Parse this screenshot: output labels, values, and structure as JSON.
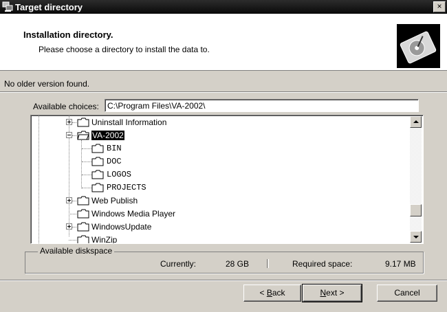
{
  "window": {
    "title": "Target directory",
    "close_symbol": "×"
  },
  "header": {
    "title": "Installation directory.",
    "subtitle": "Please choose a directory to install the data to."
  },
  "status": "No older version found.",
  "choices": {
    "label": "Available choices:",
    "path": "C:\\Program Files\\VA-2002\\"
  },
  "tree": [
    {
      "label": "Uninstall Information",
      "expander": "plus"
    },
    {
      "label": "VA-2002",
      "expander": "minus",
      "selected": true
    },
    {
      "label": "BIN"
    },
    {
      "label": "DOC"
    },
    {
      "label": "LOGOS"
    },
    {
      "label": "PROJECTS"
    },
    {
      "label": "Web Publish",
      "expander": "plus"
    },
    {
      "label": "Windows Media Player"
    },
    {
      "label": "WindowsUpdate",
      "expander": "plus"
    },
    {
      "label": "WinZip"
    }
  ],
  "diskspace": {
    "legend": "Available diskspace",
    "currently_label": "Currently:",
    "currently_value": "28 GB",
    "required_label": "Required space:",
    "required_value": "9.17 MB"
  },
  "buttons": {
    "back": {
      "pre": "< ",
      "key": "B",
      "rest": "ack"
    },
    "next": {
      "key": "N",
      "rest": "ext >"
    },
    "cancel": "Cancel"
  }
}
